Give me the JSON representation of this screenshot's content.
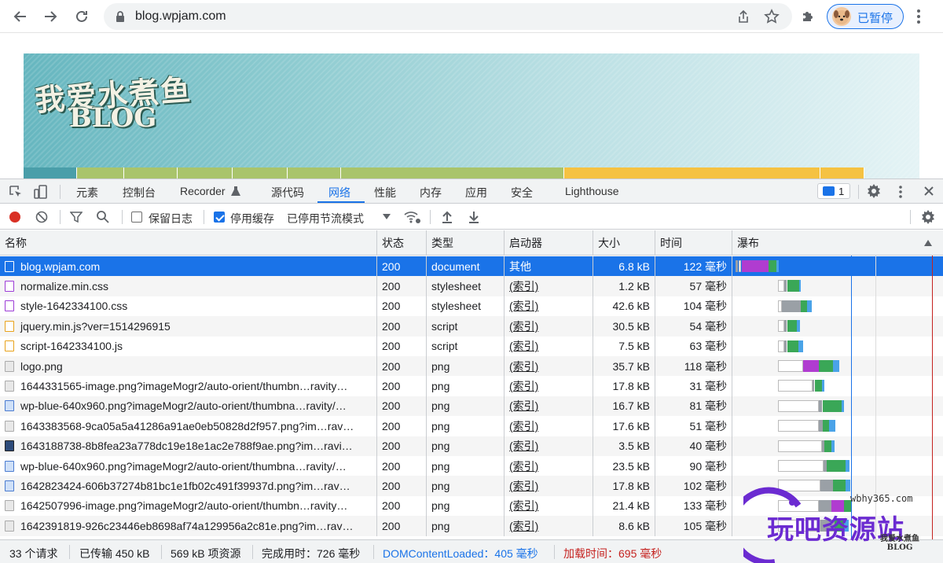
{
  "browser": {
    "url": "blog.wpjam.com",
    "profile_label": "已暂停"
  },
  "site": {
    "logo_cn": "我爱水煮鱼",
    "logo_en": "BLOG",
    "menu_colors": [
      "#4a9ea9",
      "#a9c46b",
      "#a9c46b",
      "#a9c46b",
      "#a9c46b",
      "#a9c46b",
      "#a9c46b",
      "#f5c242",
      "#f5c242"
    ]
  },
  "devtools": {
    "tabs": [
      "元素",
      "控制台",
      "Recorder",
      "源代码",
      "网络",
      "性能",
      "内存",
      "应用",
      "安全",
      "Lighthouse"
    ],
    "active_tab": "网络",
    "issues_count": "1",
    "toolbar": {
      "preserve_log": "保留日志",
      "disable_cache": "停用缓存",
      "throttle": "已停用节流模式"
    },
    "columns": [
      "名称",
      "状态",
      "类型",
      "启动器",
      "大小",
      "时间",
      "瀑布"
    ],
    "rows": [
      {
        "name": "blog.wpjam.com",
        "status": "200",
        "type": "document",
        "initiator": "其他",
        "size": "6.8 kB",
        "time": "122 毫秒",
        "icon": "doc-icon"
      },
      {
        "name": "normalize.min.css",
        "status": "200",
        "type": "stylesheet",
        "initiator": "(索引)",
        "size": "1.2 kB",
        "time": "57 毫秒",
        "icon": "css-icon"
      },
      {
        "name": "style-1642334100.css",
        "status": "200",
        "type": "stylesheet",
        "initiator": "(索引)",
        "size": "42.6 kB",
        "time": "104 毫秒",
        "icon": "css-icon"
      },
      {
        "name": "jquery.min.js?ver=1514296915",
        "status": "200",
        "type": "script",
        "initiator": "(索引)",
        "size": "30.5 kB",
        "time": "54 毫秒",
        "icon": "js-icon"
      },
      {
        "name": "script-1642334100.js",
        "status": "200",
        "type": "script",
        "initiator": "(索引)",
        "size": "7.5 kB",
        "time": "63 毫秒",
        "icon": "js-icon"
      },
      {
        "name": "logo.png",
        "status": "200",
        "type": "png",
        "initiator": "(索引)",
        "size": "35.7 kB",
        "time": "118 毫秒",
        "icon": "image-icon"
      },
      {
        "name": "1644331565-image.png?imageMogr2/auto-orient/thumbn…ravity…",
        "status": "200",
        "type": "png",
        "initiator": "(索引)",
        "size": "17.8 kB",
        "time": "31 毫秒",
        "icon": "image-icon"
      },
      {
        "name": "wp-blue-640x960.png?imageMogr2/auto-orient/thumbna…ravity/…",
        "status": "200",
        "type": "png",
        "initiator": "(索引)",
        "size": "16.7 kB",
        "time": "81 毫秒",
        "icon": "image-icon"
      },
      {
        "name": "1643383568-9ca05a5a41286a91ae0eb50828d2f957.png?im…rav…",
        "status": "200",
        "type": "png",
        "initiator": "(索引)",
        "size": "17.6 kB",
        "time": "51 毫秒",
        "icon": "image-icon"
      },
      {
        "name": "1643188738-8b8fea23a778dc19e18e1ac2e788f9ae.png?im…ravi…",
        "status": "200",
        "type": "png",
        "initiator": "(索引)",
        "size": "3.5 kB",
        "time": "40 毫秒",
        "icon": "image-icon"
      },
      {
        "name": "wp-blue-640x960.png?imageMogr2/auto-orient/thumbna…ravity/…",
        "status": "200",
        "type": "png",
        "initiator": "(索引)",
        "size": "23.5 kB",
        "time": "90 毫秒",
        "icon": "image-icon"
      },
      {
        "name": "1642823424-606b37274b81bc1e1fb02c491f39937d.png?im…rav…",
        "status": "200",
        "type": "png",
        "initiator": "(索引)",
        "size": "17.8 kB",
        "time": "102 毫秒",
        "icon": "image-icon"
      },
      {
        "name": "1642507996-image.png?imageMogr2/auto-orient/thumbn…ravity…",
        "status": "200",
        "type": "png",
        "initiator": "(索引)",
        "size": "21.4 kB",
        "time": "133 毫秒",
        "icon": "image-icon"
      },
      {
        "name": "1642391819-926c23446eb8698af74a129956a2c81e.png?im…rav…",
        "status": "200",
        "type": "png",
        "initiator": "(索引)",
        "size": "8.6 kB",
        "time": "105 毫秒",
        "icon": "image-icon"
      }
    ],
    "status_bar": {
      "requests": "33 个请求",
      "transferred": "已传输 450 kB",
      "resources": "569 kB 项资源",
      "finish": "完成用时：726 毫秒",
      "dom_content_loaded": "DOMContentLoaded：405 毫秒",
      "load": "加载时间：695 毫秒"
    }
  },
  "watermark": {
    "url": "wbhy365.com",
    "title": "玩吧资源站",
    "small_cn": "我爱水煮鱼",
    "small_en": "BLOG"
  },
  "colors": {
    "accent": "#1a73e8",
    "dom_line": "#1a73e8",
    "load_line": "#c5221f"
  }
}
